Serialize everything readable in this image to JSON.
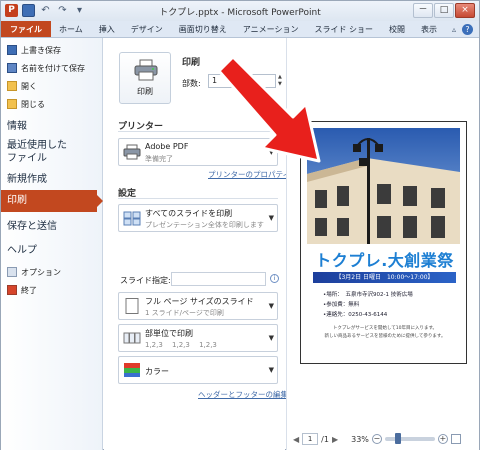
{
  "window": {
    "title": "トクプレ.pptx - Microsoft PowerPoint",
    "app_icon": "P",
    "buttons": [
      "－",
      "□",
      "×"
    ]
  },
  "qat": {
    "icons": [
      "save-icon",
      "undo-icon",
      "redo-icon"
    ]
  },
  "ribbon": {
    "tabs": [
      "ファイル",
      "ホーム",
      "挿入",
      "デザイン",
      "画面切り替え",
      "アニメーション",
      "スライド ショー",
      "校閲",
      "表示"
    ]
  },
  "nav": {
    "commands": [
      "上書き保存",
      "名前を付けて保存",
      "開く",
      "閉じる"
    ],
    "items": [
      "情報",
      "最近使用した",
      "ファイル",
      "新規作成"
    ],
    "active": "印刷",
    "items2": [
      "保存と送信",
      "ヘルプ"
    ],
    "bottom_commands": [
      "オプション",
      "終了"
    ]
  },
  "print": {
    "section_title": "印刷",
    "button_label": "印刷",
    "copies_label": "部数:",
    "copies_value": "1"
  },
  "printer": {
    "section_title": "プリンター",
    "name": "Adobe PDF",
    "status": "準備完了",
    "properties_link": "プリンターのプロパティ"
  },
  "settings": {
    "section_title": "設定",
    "range_l1": "すべてのスライドを印刷",
    "range_l2": "プレゼンテーション全体を印刷します",
    "slide_spec_label": "スライド指定:",
    "layout_l1": "フル ページ サイズのスライド",
    "layout_l2": "1 スライド/ページで印刷",
    "collate_l1": "部単位で印刷",
    "collate_l2": "1,2,3　 1,2,3　 1,2,3",
    "color_l1": "カラー",
    "header_footer_link": "ヘッダーとフッターの編集"
  },
  "preview": {
    "flyer_title": "トクプレ.大創業祭",
    "date_band": "【3月2日 日曜日　10:00～17:00】",
    "info_lines": [
      "•場所：　五泉市寺沢902-1 技術広場",
      "•参加費：無料",
      "•連絡先：0250-43-6144"
    ],
    "foot_lines": [
      "トクプレがサービスを開始して10年目に入ります。",
      "新しい商品あるサービスを皆様のために提供して参ります。"
    ],
    "page_current": "1",
    "page_total": "/1",
    "zoom": "33%"
  },
  "colors": {
    "file_tab": "#c2481f",
    "arrow": "#e8201c",
    "flyer_title": "#1d7fd3"
  }
}
